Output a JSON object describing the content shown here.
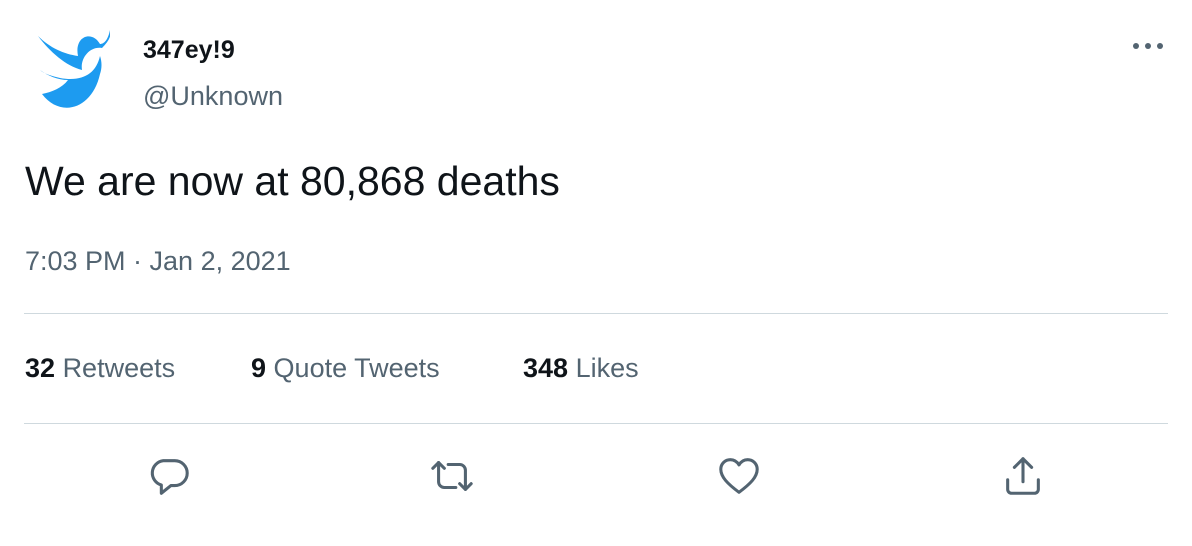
{
  "tweet": {
    "display_name": "347ey!9",
    "handle": "@Unknown",
    "text": "We are now at 80,868 deaths",
    "timestamp": "7:03 PM · Jan 2, 2021",
    "retweets_count": "32",
    "retweets_label": "Retweets",
    "quotes_count": "9",
    "quotes_label": "Quote Tweets",
    "likes_count": "348",
    "likes_label": "Likes"
  },
  "colors": {
    "brand_blue": "#1d9bf0",
    "secondary_text": "#536471",
    "divider": "#cfd9de"
  },
  "icons": [
    "twitter-bird-icon",
    "more-icon",
    "reply-icon",
    "retweet-icon",
    "like-icon",
    "share-icon"
  ]
}
